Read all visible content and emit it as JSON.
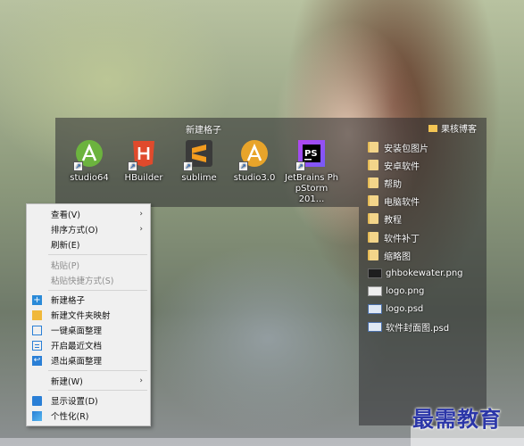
{
  "fence_apps": {
    "title": "新建格子",
    "apps": [
      {
        "label": "studio64",
        "icon": "android-studio-icon"
      },
      {
        "label": "HBuilder",
        "icon": "hbuilder-icon"
      },
      {
        "label": "sublime",
        "icon": "sublime-icon"
      },
      {
        "label": "studio3.0",
        "icon": "android-studio-icon"
      },
      {
        "label": "JetBrains PhpStorm 201...",
        "label_line1": "JetBrains Ph",
        "label_line2": "pStorm 201...",
        "icon": "phpstorm-icon"
      }
    ]
  },
  "fence_files": {
    "title": "果核博客",
    "items": [
      {
        "label": "安装包图片",
        "type": "folder"
      },
      {
        "label": "安卓软件",
        "type": "folder"
      },
      {
        "label": "帮助",
        "type": "folder"
      },
      {
        "label": "电脑软件",
        "type": "folder"
      },
      {
        "label": "教程",
        "type": "folder"
      },
      {
        "label": "软件补丁",
        "type": "folder"
      },
      {
        "label": "缩略图",
        "type": "folder"
      },
      {
        "label": "ghbokewater.png",
        "type": "png"
      },
      {
        "label": "logo.png",
        "type": "png"
      },
      {
        "label": "logo.psd",
        "type": "psd"
      },
      {
        "label": "软件封面图.psd",
        "type": "psd"
      }
    ]
  },
  "context_menu": {
    "view": "查看(V)",
    "sort": "排序方式(O)",
    "refresh": "刷新(E)",
    "paste": "粘贴(P)",
    "paste_shortcut": "粘贴快捷方式(S)",
    "new_fence": "新建格子",
    "new_folder_map": "新建文件夹映射",
    "desktop_organize": "一键桌面整理",
    "recent_docs": "开启最近文档",
    "exit_organize": "退出桌面整理",
    "new": "新建(W)",
    "display_settings": "显示设置(D)",
    "personalize": "个性化(R)"
  },
  "watermark": "最需教育",
  "colors": {
    "fence_bg": "#2d2d32",
    "menu_bg": "#f0f0f0",
    "brand": "#2b36a8",
    "icon_blue": "#2a7fd6"
  }
}
